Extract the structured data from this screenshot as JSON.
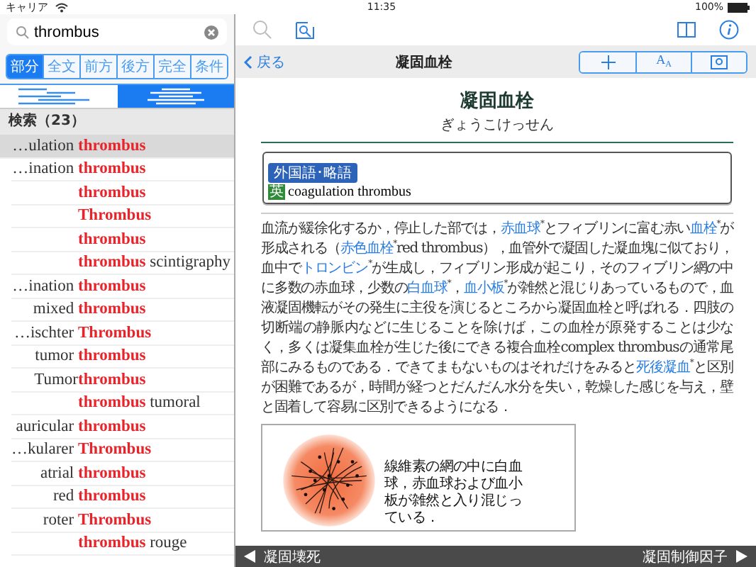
{
  "status_bar": {
    "carrier": "キャリア",
    "time": "11:35",
    "battery": "100%"
  },
  "search": {
    "value": "thrombus"
  },
  "match_tabs": [
    {
      "label": "部分",
      "selected": true
    },
    {
      "label": "全文",
      "selected": false
    },
    {
      "label": "前方",
      "selected": false
    },
    {
      "label": "後方",
      "selected": false
    },
    {
      "label": "完全",
      "selected": false
    },
    {
      "label": "条件",
      "selected": false
    }
  ],
  "view_toggle": [
    {
      "kind": "left",
      "selected": false
    },
    {
      "kind": "center",
      "selected": true
    }
  ],
  "results_header": "検索（23）",
  "results": [
    {
      "prefix": "…ulation ",
      "term": "thrombus",
      "selected": true
    },
    {
      "prefix": "…ination ",
      "term": "thrombus",
      "selected": false
    },
    {
      "term": "thrombus",
      "selected": false
    },
    {
      "term": "Thrombus",
      "selected": false
    },
    {
      "term": "thrombus",
      "selected": false
    },
    {
      "term": "thrombus",
      "suffix": " scintigraphy",
      "selected": false
    },
    {
      "prefix": "…ination ",
      "term": "thrombus",
      "selected": false
    },
    {
      "prefix": "mixed ",
      "term": "thrombus",
      "selected": false
    },
    {
      "prefix": "…ischter ",
      "term": "Thrombus",
      "selected": false
    },
    {
      "prefix": "tumor ",
      "term": "thrombus",
      "selected": false
    },
    {
      "prefix": "Tumor",
      "term": "thrombus",
      "selected": false
    },
    {
      "term": "thrombus",
      "suffix": " tumoral",
      "selected": false
    },
    {
      "prefix": "auricular ",
      "term": "thrombus",
      "selected": false
    },
    {
      "prefix": "…kularer ",
      "term": "Thrombus",
      "selected": false
    },
    {
      "prefix": "atrial ",
      "term": "thrombus",
      "selected": false
    },
    {
      "prefix": "red ",
      "term": "thrombus",
      "selected": false
    },
    {
      "prefix": "roter ",
      "term": "Thrombus",
      "selected": false
    },
    {
      "term": "thrombus",
      "suffix": " rouge",
      "selected": false
    }
  ],
  "nav": {
    "back": "戻る",
    "title": "凝固血栓",
    "font_button": {
      "large": "A",
      "small": "A"
    }
  },
  "entry": {
    "headword": "凝固血栓",
    "reading": "ぎょうこけっせん",
    "foreign_box": {
      "label": "外国語･略語",
      "lang": "英",
      "term": "coagulation thrombus"
    },
    "body": [
      {
        "kind": "text",
        "text": "血流が緩徐化するか，停止した部では，"
      },
      {
        "kind": "link",
        "text": "赤血球"
      },
      {
        "kind": "text",
        "text": "$^{*}$とフィブリンに富む赤い"
      },
      {
        "kind": "link",
        "text": "血栓"
      },
      {
        "kind": "text",
        "text": "$^{*}$が形成される（"
      },
      {
        "kind": "link",
        "text": "赤色血栓"
      },
      {
        "kind": "text",
        "text": "$^{*}$red thrombus），血管外で凝固した凝血塊に似ており，血中で"
      },
      {
        "kind": "link",
        "text": "トロンビン"
      },
      {
        "kind": "text",
        "text": "$^{*}$が生成し，フィブリン形成が起こり，そのフィブリン網の中に多数の赤血球，少数の"
      },
      {
        "kind": "link",
        "text": "白血球"
      },
      {
        "kind": "text",
        "text": "$^{*}$，"
      },
      {
        "kind": "link",
        "text": "血小板"
      },
      {
        "kind": "text",
        "text": "$^{*}$が雑然と混じりあっているもので，血液凝固機転がその発生に主役を演じるところから凝固血栓と呼ばれる．四肢の切断端の静脈内などに生じることを除けば，この血栓が原発することは少なく，多くは凝集血栓が生じた後にできる複合血栓complex thrombusの通常尾部にみるものである．できてまもないものはそれだけをみると"
      },
      {
        "kind": "link",
        "text": "死後凝血"
      },
      {
        "kind": "text",
        "text": "$^{*}$と区別が困難であるが，時間が経つとだんだん水分を失い，乾燥した感じを与え，壁と固着して容易に区別できるようになる．"
      }
    ],
    "figure_caption": "線維素の網の中に白血球，赤血球および血小板が雑然と入り混じっている．"
  },
  "footer": {
    "previous": "凝固壊死",
    "next": "凝固制御因子"
  }
}
